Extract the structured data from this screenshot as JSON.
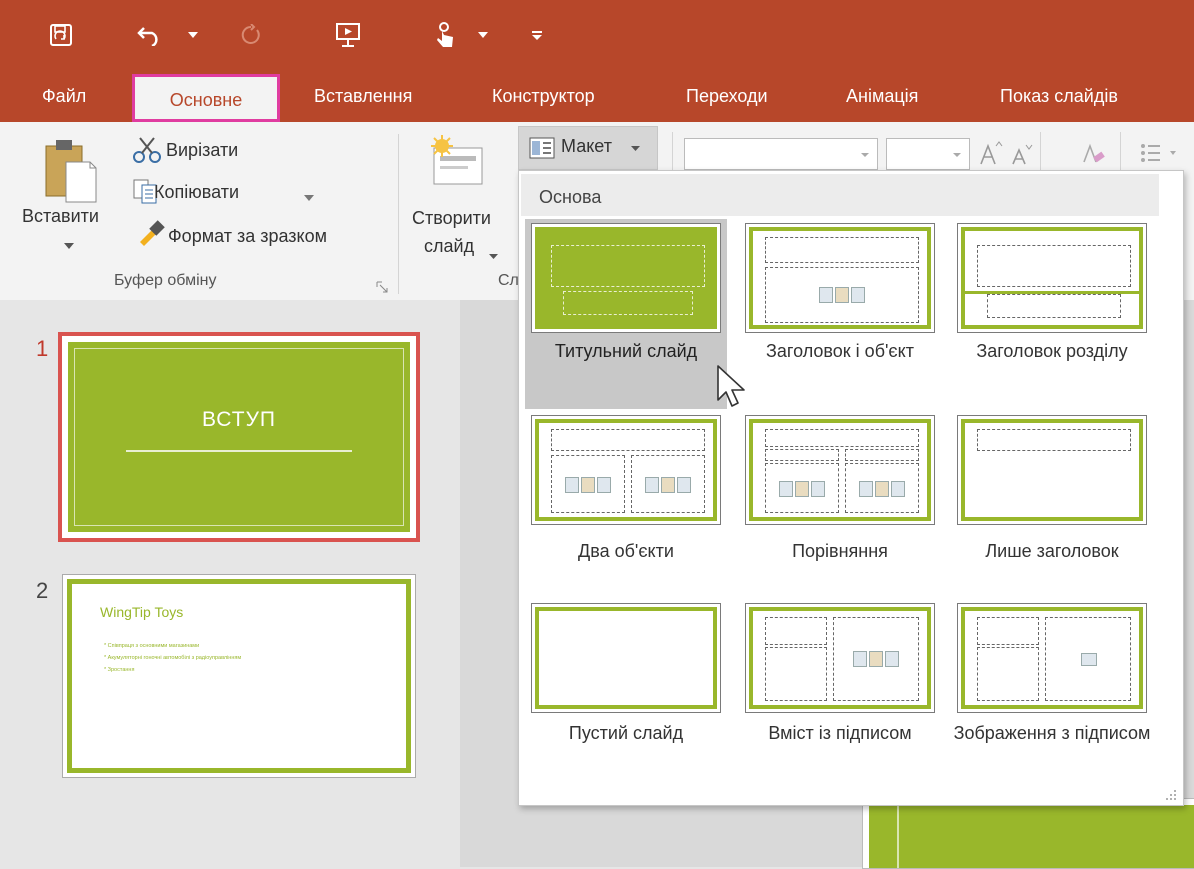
{
  "qat": {
    "icons": [
      "save-icon",
      "undo-icon",
      "undo-dropdown-icon",
      "redo-icon",
      "start-from-beginning-icon",
      "touch-mode-icon",
      "touch-dropdown-icon",
      "customize-qat-icon"
    ]
  },
  "menu": {
    "tabs": [
      {
        "label": "Файл"
      },
      {
        "label": "Основне",
        "active": true
      },
      {
        "label": "Вставлення"
      },
      {
        "label": "Конструктор"
      },
      {
        "label": "Переходи"
      },
      {
        "label": "Анімація"
      },
      {
        "label": "Показ слайдів"
      }
    ]
  },
  "ribbon": {
    "clipboard": {
      "paste": "Вставити",
      "cut": "Вирізати",
      "copy": "Копіювати",
      "format_painter": "Формат за зразком",
      "group_label": "Буфер обміну"
    },
    "slides": {
      "new_slide_line1": "Створити",
      "new_slide_line2": "слайд",
      "layout": "Макет",
      "group_label_partial": "Сл"
    }
  },
  "slides": [
    {
      "number": "1",
      "title": "ВСТУП"
    },
    {
      "number": "2",
      "title": "WingTip Toys",
      "bullets": [
        "Співпраця з основними магазинами",
        "Акумуляторні гоночні автомобілі з радіоуправлінням",
        "Зростання"
      ]
    }
  ],
  "layout_menu": {
    "header": "Основа",
    "items": [
      {
        "label": "Титульний слайд",
        "selected": true
      },
      {
        "label": "Заголовок і об'єкт"
      },
      {
        "label": "Заголовок розділу"
      },
      {
        "label": "Два об'єкти"
      },
      {
        "label": "Порівняння"
      },
      {
        "label": "Лише заголовок"
      },
      {
        "label": "Пустий слайд"
      },
      {
        "label": "Вміст із підписом"
      },
      {
        "label": "Зображення з підписом"
      }
    ]
  },
  "colors": {
    "accent": "#b7472a",
    "theme_green": "#99b72b",
    "highlight_box": "#e03ca0"
  }
}
